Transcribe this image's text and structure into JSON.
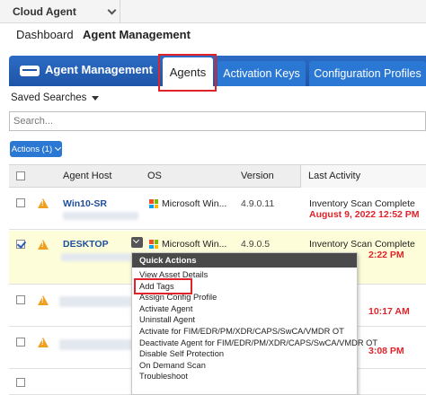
{
  "app": {
    "name": "Cloud Agent"
  },
  "nav": {
    "dashboard": "Dashboard",
    "agent_management": "Agent Management"
  },
  "module": {
    "title": "Agent Management"
  },
  "tabs": {
    "agents": "Agents",
    "activation_keys": "Activation Keys",
    "configuration_profiles": "Configuration Profiles"
  },
  "saved_searches": {
    "label": "Saved Searches"
  },
  "search": {
    "placeholder": "Search..."
  },
  "actions": {
    "label": "Actions (1)"
  },
  "table": {
    "headers": {
      "host": "Agent Host",
      "os": "OS",
      "version": "Version",
      "activity": "Last Activity"
    },
    "rows": [
      {
        "host": "Win10-SR",
        "os": "Microsoft Win...",
        "version": "4.9.0.11",
        "activity": "Inventory Scan Complete",
        "date": "August 9, 2022 12:52 PM",
        "checked": false
      },
      {
        "host": "DESKTOP",
        "os": "Microsoft Win...",
        "version": "4.9.0.5",
        "activity": "Inventory Scan Complete",
        "date": "2:22 PM",
        "checked": true
      },
      {
        "host": "",
        "os": "",
        "version": "",
        "activity": "",
        "date": "10:17 AM",
        "checked": false
      },
      {
        "host": "",
        "os": "",
        "version": "",
        "activity": "",
        "date": "3:08 PM",
        "checked": false
      }
    ]
  },
  "quick_actions": {
    "title": "Quick Actions",
    "items": [
      "View Asset Details",
      "Add Tags",
      "Assign Config Profile",
      "Activate Agent",
      "Uninstall Agent",
      "Activate for FIM/EDR/PM/XDR/CAPS/SwCA/VMDR OT",
      "Deactivate Agent for FIM/EDR/PM/XDR/CAPS/SwCA/VMDR OT",
      "Disable Self Protection",
      "On Demand Scan",
      "Troubleshoot"
    ]
  },
  "colors": {
    "brand_blue": "#1e55a8",
    "tab_blue": "#2a78d4",
    "highlight_red": "#e0232b",
    "warning_orange": "#f0a020",
    "selected_row": "#fdfdd9"
  }
}
